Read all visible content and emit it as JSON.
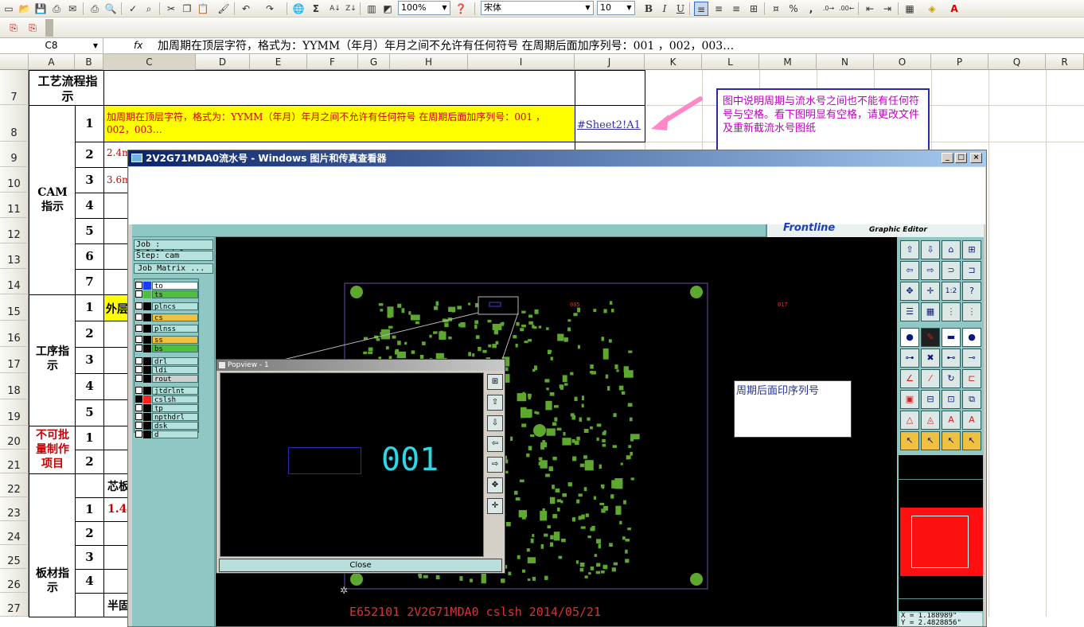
{
  "toolbar": {
    "zoom": "100%",
    "font_name": "宋体",
    "font_size": "10",
    "bold": "B",
    "italic": "I",
    "underline": "U",
    "percent": "%",
    "comma": ",",
    "sigma": "Σ",
    "text_color_letter": "A"
  },
  "formula_bar": {
    "cell_ref": "C8",
    "fx": "fx",
    "content": "加周期在顶层字符，格式为：YYMM（年月）年月之间不允许有任何符号 在周期后面加序列号：001 ，002，003…"
  },
  "columns": [
    "A",
    "B",
    "C",
    "D",
    "E",
    "F",
    "G",
    "H",
    "I",
    "J",
    "K",
    "L",
    "M",
    "N",
    "O",
    "P",
    "Q",
    "R"
  ],
  "rows": [
    "7",
    "8",
    "9",
    "10",
    "11",
    "12",
    "13",
    "14",
    "15",
    "16",
    "17",
    "18",
    "19",
    "20",
    "21",
    "22",
    "23",
    "24",
    "25",
    "26",
    "27"
  ],
  "cells": {
    "process_header": "工艺流程指示",
    "cam_label": "CAM指示",
    "process_label": "工序指示",
    "no_batch_label": "不可批量制作项目",
    "board_label": "板材指示",
    "c8_text": "加周期在顶层字符，格式为：YYMM（年月）年月之间不允许有任何符号 在周期后面加序列号：001 ，002，003…",
    "c9_text": "2.4m",
    "c10_text": "3.6m",
    "c15_text": "外层",
    "c22_text": "芯板",
    "c23_text": "1.4",
    "c27_text": "半固",
    "j8_link": "#Sheet2!A1",
    "b_numbers": [
      "1",
      "2",
      "3",
      "4",
      "5",
      "6",
      "7"
    ],
    "b_process_numbers": [
      "1",
      "2",
      "3",
      "4",
      "5"
    ],
    "b_batch_numbers": [
      "1",
      "2"
    ],
    "b_board_numbers": [
      "1",
      "2",
      "3",
      "4"
    ]
  },
  "note": "图中说明周期与流水号之间也不能有任何符号与空格。看下图明显有空格，请更改文件及重新截流水号图纸",
  "viewer_window": {
    "title": "2V2G71MDA0流水号 - Windows 图片和传真查看器",
    "minimize": "_",
    "maximize": "□",
    "close": "×"
  },
  "graphic_editor": {
    "brand": "Frontline",
    "subtitle": "Graphic Editor",
    "job": "Job : 2v2g71mda0",
    "step": "Step: cam",
    "job_matrix": "Job Matrix ...",
    "layers": [
      {
        "name": "to",
        "color": "#1a3cff"
      },
      {
        "name": "ts",
        "color": "#4fbf3f"
      },
      {
        "name": "plncs",
        "color": "#7f9f9f"
      },
      {
        "name": "cs",
        "color": "#f0c040"
      },
      {
        "name": "plnss",
        "color": "#7f9f9f"
      },
      {
        "name": "ss",
        "color": "#f0c040"
      },
      {
        "name": "bs",
        "color": "#4fbf3f"
      },
      {
        "name": "drl",
        "color": "#7f9f9f"
      },
      {
        "name": "ldi",
        "color": "#7f9f9f"
      },
      {
        "name": "rout",
        "color": "#7f9f9f"
      },
      {
        "name": "jtdrlnt",
        "color": "#7f9f9f"
      },
      {
        "name": "cslsh",
        "color": "#ff2020"
      },
      {
        "name": "tp",
        "color": "#7f9f9f"
      },
      {
        "name": "npthdrl",
        "color": "#7f9f9f"
      },
      {
        "name": "dsk",
        "color": "#7f9f9f"
      },
      {
        "name": "d",
        "color": "#7f9f9f"
      }
    ],
    "canvas_marks": [
      "005",
      "017"
    ],
    "annotation": "周期后面印序列号",
    "footer_text": "E652101 2V2G71MDA0 cslsh 2014/05/21",
    "coord_x": "X = 1.188989\"",
    "coord_y": "Y = 2.4828856\""
  },
  "popview": {
    "title": "Popview - 1",
    "serial": "001",
    "close": "Close"
  },
  "colors": {
    "yellow_cell": "#ffff00",
    "red_text": "#cc0000",
    "note_border": "#2a2aa8",
    "note_text": "#c000c0",
    "pcb_green": "#5fa82f",
    "serial_cyan": "#2ad8e8",
    "arrow_pink": "#ff88c8"
  }
}
